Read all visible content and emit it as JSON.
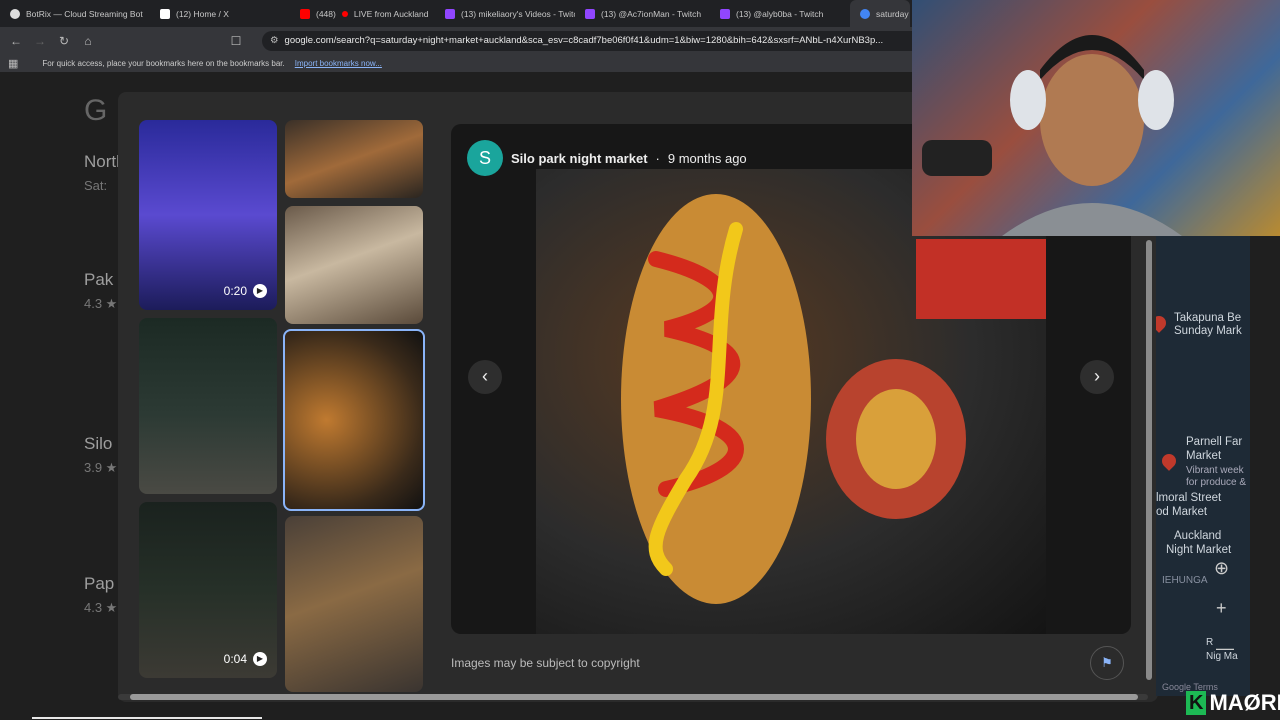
{
  "tabs": [
    {
      "label": "BotRix — Cloud Streaming Bot",
      "icon": "botrix-icon",
      "color": "#ffffff"
    },
    {
      "label": "(12) Home / X",
      "icon": "x-logo-icon",
      "color": "#ffffff"
    },
    {
      "label": "(448)",
      "icon": "youtube-icon",
      "color": "#ff0000"
    },
    {
      "label": "LIVE from Auckland",
      "icon": "live-dot-icon",
      "color": "#ff0000"
    },
    {
      "label": "(13) mikeliaory's Videos - Twitch",
      "icon": "twitch-icon",
      "color": "#9146ff"
    },
    {
      "label": "(13) @Ac7ionMan - Twitch",
      "icon": "twitch-icon",
      "color": "#9146ff"
    },
    {
      "label": "(13) @alyb0ba - Twitch",
      "icon": "twitch-icon",
      "color": "#9146ff"
    },
    {
      "label": "saturday",
      "icon": "google-icon",
      "color": "#4285f4"
    }
  ],
  "url": "google.com/search?q=saturday+night+market+auckland&sca_esv=c8cadf7be06f0f41&udm=1&biw=1280&bih=642&sxsrf=ANbL-n4XurNB3p...",
  "bookmarks": {
    "text": "For quick access, place your bookmarks here on the bookmarks bar.",
    "link": "Import bookmarks now..."
  },
  "results": [
    {
      "title": "North",
      "sub": "Sat:"
    },
    {
      "title": "Pak",
      "sub": "4.3 ★"
    },
    {
      "title": "Silo",
      "sub": "3.9 ★"
    },
    {
      "title": "Pap",
      "sub": "4.3 ★"
    }
  ],
  "thumbnails": [
    {
      "duration": "0:20"
    },
    {
      "duration": "0:04"
    }
  ],
  "viewer": {
    "avatar_letter": "S",
    "source": "Silo park night market",
    "separator": "·",
    "age": "9 months ago",
    "copyright": "Images may be subject to copyright"
  },
  "map": {
    "labels": [
      "Takapuna Be",
      "Sunday Mark",
      "Parnell Far",
      "Market",
      "Vibrant week",
      "for produce &",
      "lmoral Street",
      "od Market",
      "Auckland",
      "Night Market",
      "IEHUNGA",
      "R",
      "Nig Ma"
    ],
    "footer": "Google Terms"
  },
  "logo": {
    "k": "K",
    "text": "MAØRI"
  },
  "colors": {
    "accent": "#8ab4f8",
    "avatar": "#1aa59c",
    "selected_border": "#8ab4f8"
  }
}
